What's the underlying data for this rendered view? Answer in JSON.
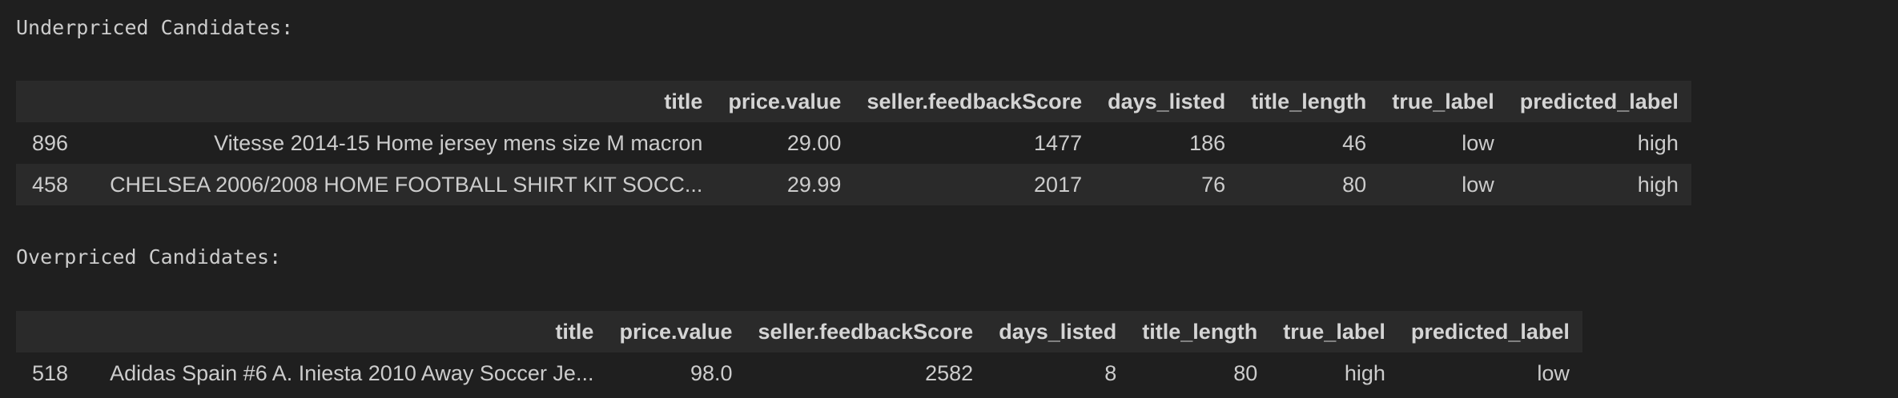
{
  "output": {
    "underpriced_label": "Underpriced Candidates:",
    "overpriced_label": "Overpriced Candidates:"
  },
  "columns": [
    "title",
    "price.value",
    "seller.feedbackScore",
    "days_listed",
    "title_length",
    "true_label",
    "predicted_label"
  ],
  "underpriced": {
    "rows": [
      {
        "index": "896",
        "title": "Vitesse 2014-15 Home jersey mens size M macron",
        "price": "29.00",
        "feedback": "1477",
        "days": "186",
        "title_length": "46",
        "true_label": "low",
        "predicted_label": "high"
      },
      {
        "index": "458",
        "title": "CHELSEA 2006/2008 HOME FOOTBALL SHIRT KIT SOCC...",
        "price": "29.99",
        "feedback": "2017",
        "days": "76",
        "title_length": "80",
        "true_label": "low",
        "predicted_label": "high"
      }
    ]
  },
  "overpriced": {
    "rows": [
      {
        "index": "518",
        "title": "Adidas Spain #6 A. Iniesta 2010 Away Soccer Je...",
        "price": "98.0",
        "feedback": "2582",
        "days": "8",
        "title_length": "80",
        "true_label": "high",
        "predicted_label": "low"
      }
    ]
  }
}
